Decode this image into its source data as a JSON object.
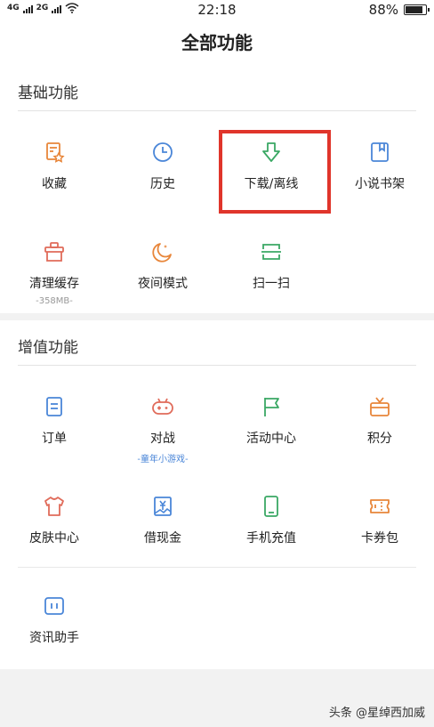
{
  "status_bar": {
    "network_left": "4G",
    "network_right": "2G",
    "time": "22:18",
    "battery": "88%",
    "battery_level": 0.88
  },
  "header": {
    "title": "全部功能"
  },
  "basic": {
    "title": "基础功能",
    "items": [
      {
        "label": "收藏",
        "icon": "bookmark-star-icon"
      },
      {
        "label": "历史",
        "icon": "clock-icon"
      },
      {
        "label": "下载/离线",
        "icon": "download-arrow-icon"
      },
      {
        "label": "小说书架",
        "icon": "book-icon"
      },
      {
        "label": "清理缓存",
        "sub": "-358MB-",
        "icon": "clean-basket-icon"
      },
      {
        "label": "夜间模式",
        "icon": "moon-icon"
      },
      {
        "label": "扫一扫",
        "icon": "scan-icon"
      }
    ]
  },
  "value_added": {
    "title": "增值功能",
    "items": [
      {
        "label": "订单",
        "icon": "order-icon"
      },
      {
        "label": "对战",
        "sub": "-童年小游戏-",
        "icon": "gamepad-icon"
      },
      {
        "label": "活动中心",
        "icon": "flag-icon"
      },
      {
        "label": "积分",
        "icon": "gift-tv-icon"
      },
      {
        "label": "皮肤中心",
        "icon": "shirt-icon"
      },
      {
        "label": "借现金",
        "icon": "cash-icon"
      },
      {
        "label": "手机充值",
        "icon": "phone-icon"
      },
      {
        "label": "卡券包",
        "icon": "ticket-icon"
      },
      {
        "label": "资讯助手",
        "icon": "news-icon"
      }
    ]
  },
  "watermark": "头条 @星绰西加威",
  "colors": {
    "orange": "#e8863a",
    "blue": "#4a86d8",
    "green": "#3aa864",
    "red": "#e06b5a",
    "highlight": "#e0352b"
  }
}
